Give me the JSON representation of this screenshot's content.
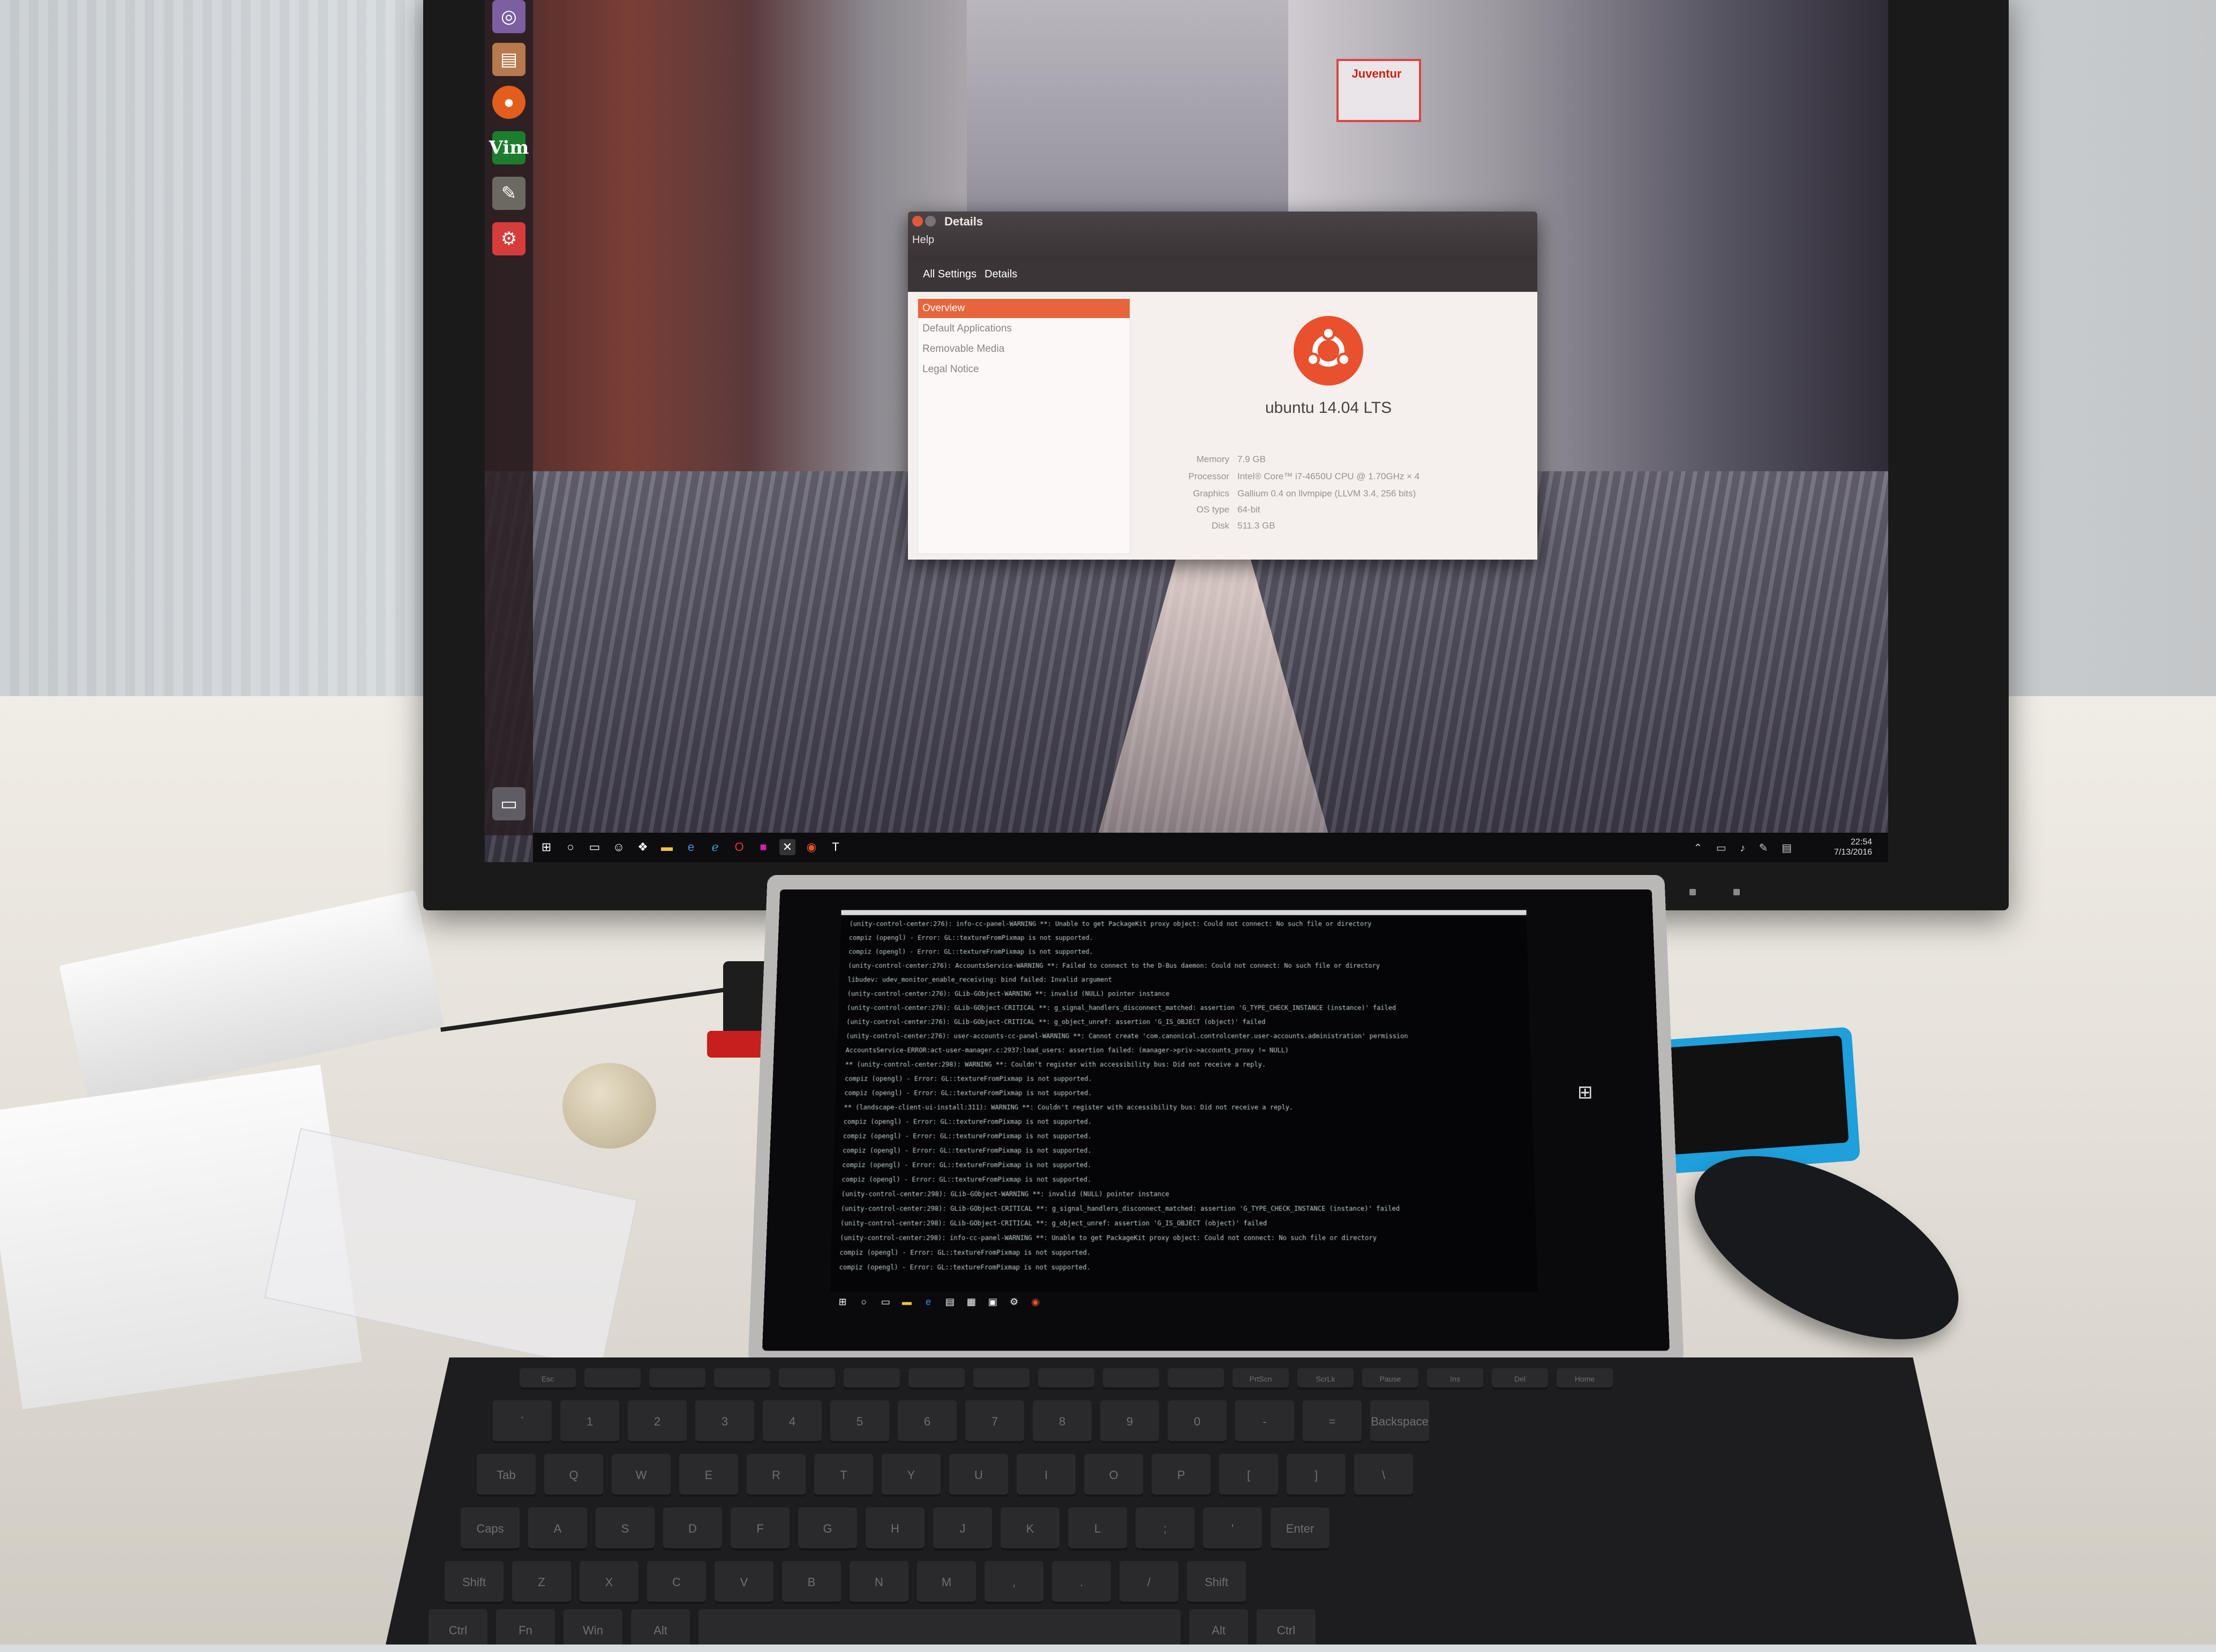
{
  "details_window": {
    "title": "Details",
    "menu": "Help",
    "breadcrumb": [
      "All Settings",
      "Details"
    ],
    "sidebar": [
      "Overview",
      "Default Applications",
      "Removable Media",
      "Legal Notice"
    ],
    "active_item": "Overview",
    "os_name": "ubuntu 14.04 LTS",
    "specs": [
      {
        "label": "Memory",
        "value": "7.9 GB"
      },
      {
        "label": "Processor",
        "value": "Intel® Core™ i7-4650U CPU @ 1.70GHz × 4"
      },
      {
        "label": "Graphics",
        "value": "Gallium 0.4 on llvmpipe (LLVM 3.4, 256 bits)"
      },
      {
        "label": "OS type",
        "value": "64-bit"
      },
      {
        "label": "Disk",
        "value": "511.3 GB"
      }
    ]
  },
  "launcher": {
    "icons": [
      "dash-icon",
      "files-icon",
      "firefox-icon",
      "vim-icon",
      "text-editor-icon",
      "system-settings-icon",
      "trash-icon"
    ],
    "vim_label": "Vim"
  },
  "monitor_taskbar": {
    "clock_time": "22:54",
    "clock_date": "7/13/2016"
  },
  "wallpaper": {
    "sign": "Juventur"
  },
  "terminal": {
    "lines": [
      "(unity-control-center:276): info-cc-panel-WARNING **: Unable to get PackageKit proxy object: Could not connect: No such file or directory",
      "compiz (opengl) - Error: GL::textureFromPixmap is not supported.",
      "compiz (opengl) - Error: GL::textureFromPixmap is not supported.",
      "(unity-control-center:276): AccountsService-WARNING **: Failed to connect to the D-Bus daemon: Could not connect: No such file or directory",
      "libudev: udev_monitor_enable_receiving: bind failed: Invalid argument",
      "(unity-control-center:276): GLib-GObject-WARNING **: invalid (NULL) pointer instance",
      "(unity-control-center:276): GLib-GObject-CRITICAL **: g_signal_handlers_disconnect_matched: assertion 'G_TYPE_CHECK_INSTANCE (instance)' failed",
      "(unity-control-center:276): GLib-GObject-CRITICAL **: g_object_unref: assertion 'G_IS_OBJECT (object)' failed",
      "(unity-control-center:276): user-accounts-cc-panel-WARNING **: Cannot create 'com.canonical.controlcenter.user-accounts.administration' permission",
      "AccountsService-ERROR:act-user-manager.c:2937:load_users: assertion failed: (manager->priv->accounts_proxy != NULL)",
      "** (unity-control-center:298): WARNING **: Couldn't register with accessibility bus: Did not receive a reply.",
      "compiz (opengl) - Error: GL::textureFromPixmap is not supported.",
      "compiz (opengl) - Error: GL::textureFromPixmap is not supported.",
      "** (landscape-client-ui-install:311): WARNING **: Couldn't register with accessibility bus: Did not receive a reply.",
      "compiz (opengl) - Error: GL::textureFromPixmap is not supported.",
      "compiz (opengl) - Error: GL::textureFromPixmap is not supported.",
      "compiz (opengl) - Error: GL::textureFromPixmap is not supported.",
      "compiz (opengl) - Error: GL::textureFromPixmap is not supported.",
      "compiz (opengl) - Error: GL::textureFromPixmap is not supported.",
      "(unity-control-center:298): GLib-GObject-WARNING **: invalid (NULL) pointer instance",
      "(unity-control-center:298): GLib-GObject-CRITICAL **: g_signal_handlers_disconnect_matched: assertion 'G_TYPE_CHECK_INSTANCE (instance)' failed",
      "(unity-control-center:298): GLib-GObject-CRITICAL **: g_object_unref: assertion 'G_IS_OBJECT (object)' failed",
      "(unity-control-center:298): info-cc-panel-WARNING **: Unable to get PackageKit proxy object: Could not connect: No such file or directory",
      "compiz (opengl) - Error: GL::textureFromPixmap is not supported.",
      "compiz (opengl) - Error: GL::textureFromPixmap is not supported."
    ]
  },
  "keyboard": {
    "fn_row": [
      "Esc",
      "",
      "",
      "",
      "",
      "",
      "",
      "",
      "",
      "",
      "",
      "PrtScn",
      "ScrLk",
      "Pause",
      "Ins",
      "Del",
      "Home"
    ],
    "row1": [
      "`",
      "1",
      "2",
      "3",
      "4",
      "5",
      "6",
      "7",
      "8",
      "9",
      "0",
      "-",
      "=",
      "Backspace"
    ],
    "row2": [
      "Tab",
      "Q",
      "W",
      "E",
      "R",
      "T",
      "Y",
      "U",
      "I",
      "O",
      "P",
      "[",
      "]",
      "\\"
    ],
    "row3": [
      "Caps",
      "A",
      "S",
      "D",
      "F",
      "G",
      "H",
      "J",
      "K",
      "L",
      ";",
      "'",
      "Enter"
    ],
    "row4": [
      "Shift",
      "Z",
      "X",
      "C",
      "V",
      "B",
      "N",
      "M",
      ",",
      ".",
      "/",
      "Shift"
    ],
    "row5": [
      "Ctrl",
      "Fn",
      "Win",
      "Alt",
      "",
      "Alt",
      "Ctrl"
    ]
  }
}
